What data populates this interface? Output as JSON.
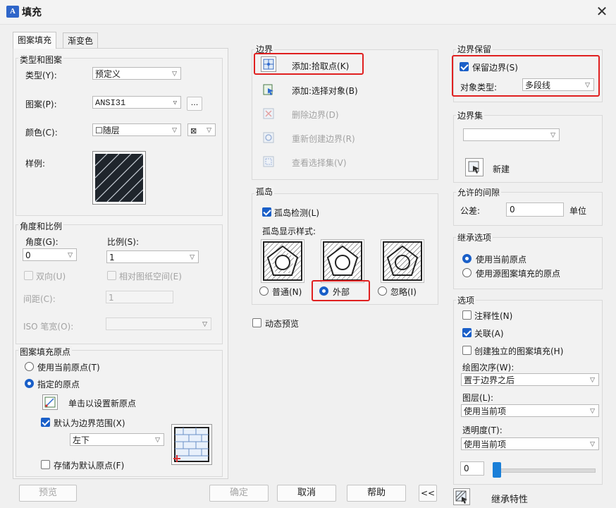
{
  "window": {
    "title": "填充"
  },
  "tabs": [
    "图案填充",
    "渐变色"
  ],
  "type_pattern": {
    "group": "类型和图案",
    "type_label": "类型(Y):",
    "type_value": "预定义",
    "pattern_label": "图案(P):",
    "pattern_value": "ANSI31",
    "more_btn": "...",
    "color_label": "颜色(C):",
    "color_value": "☐随层",
    "sample_label": "样例:"
  },
  "angle_scale": {
    "group": "角度和比例",
    "angle_label": "角度(G):",
    "angle_value": "0",
    "scale_label": "比例(S):",
    "scale_value": "1",
    "double_label": "双向(U)",
    "relative_label": "相对图纸空间(E)",
    "spacing_label": "间距(C):",
    "spacing_value": "1",
    "iso_label": "ISO 笔宽(O):"
  },
  "origin": {
    "group": "图案填充原点",
    "use_current": "使用当前原点(T)",
    "specified": "指定的原点",
    "click_set": "单击以设置新原点",
    "default_boundary": "默认为边界范围(X)",
    "position_value": "左下",
    "store_default": "存储为默认原点(F)"
  },
  "boundary": {
    "group": "边界",
    "add_pick": "添加:拾取点(K)",
    "add_select": "添加:选择对象(B)",
    "remove": "删除边界(D)",
    "recreate": "重新创建边界(R)",
    "view_select": "查看选择集(V)"
  },
  "island": {
    "group": "孤岛",
    "detect": "孤岛检测(L)",
    "style_label": "孤岛显示样式:",
    "normal": "普通(N)",
    "outer": "外部",
    "ignore": "忽略(I)"
  },
  "dynamic_preview": "动态预览",
  "retain": {
    "group": "边界保留",
    "retain_label": "保留边界(S)",
    "object_type_label": "对象类型:",
    "object_type_value": "多段线"
  },
  "boundary_set": {
    "group": "边界集",
    "new_label": "新建"
  },
  "gap": {
    "group": "允许的间隙",
    "tolerance_label": "公差:",
    "tolerance_value": "0",
    "unit_label": "单位"
  },
  "inherit": {
    "group": "继承选项",
    "use_current": "使用当前原点",
    "use_source": "使用源图案填充的原点"
  },
  "options": {
    "group": "选项",
    "annotative": "注释性(N)",
    "associative": "关联(A)",
    "separate": "创建独立的图案填充(H)",
    "draw_order_label": "绘图次序(W):",
    "draw_order_value": "置于边界之后",
    "layer_label": "图层(L):",
    "layer_value": "使用当前项",
    "transparency_label": "透明度(T):",
    "transparency_value": "使用当前项",
    "slider_value": "0"
  },
  "footer": {
    "preview": "预览",
    "ok": "确定",
    "cancel": "取消",
    "help": "帮助",
    "collapse": "<<",
    "inherit_props": "继承特性"
  },
  "colors": {
    "accent": "#1a5fc8",
    "highlight": "#e02020",
    "sample_bg": "#1f252c"
  }
}
